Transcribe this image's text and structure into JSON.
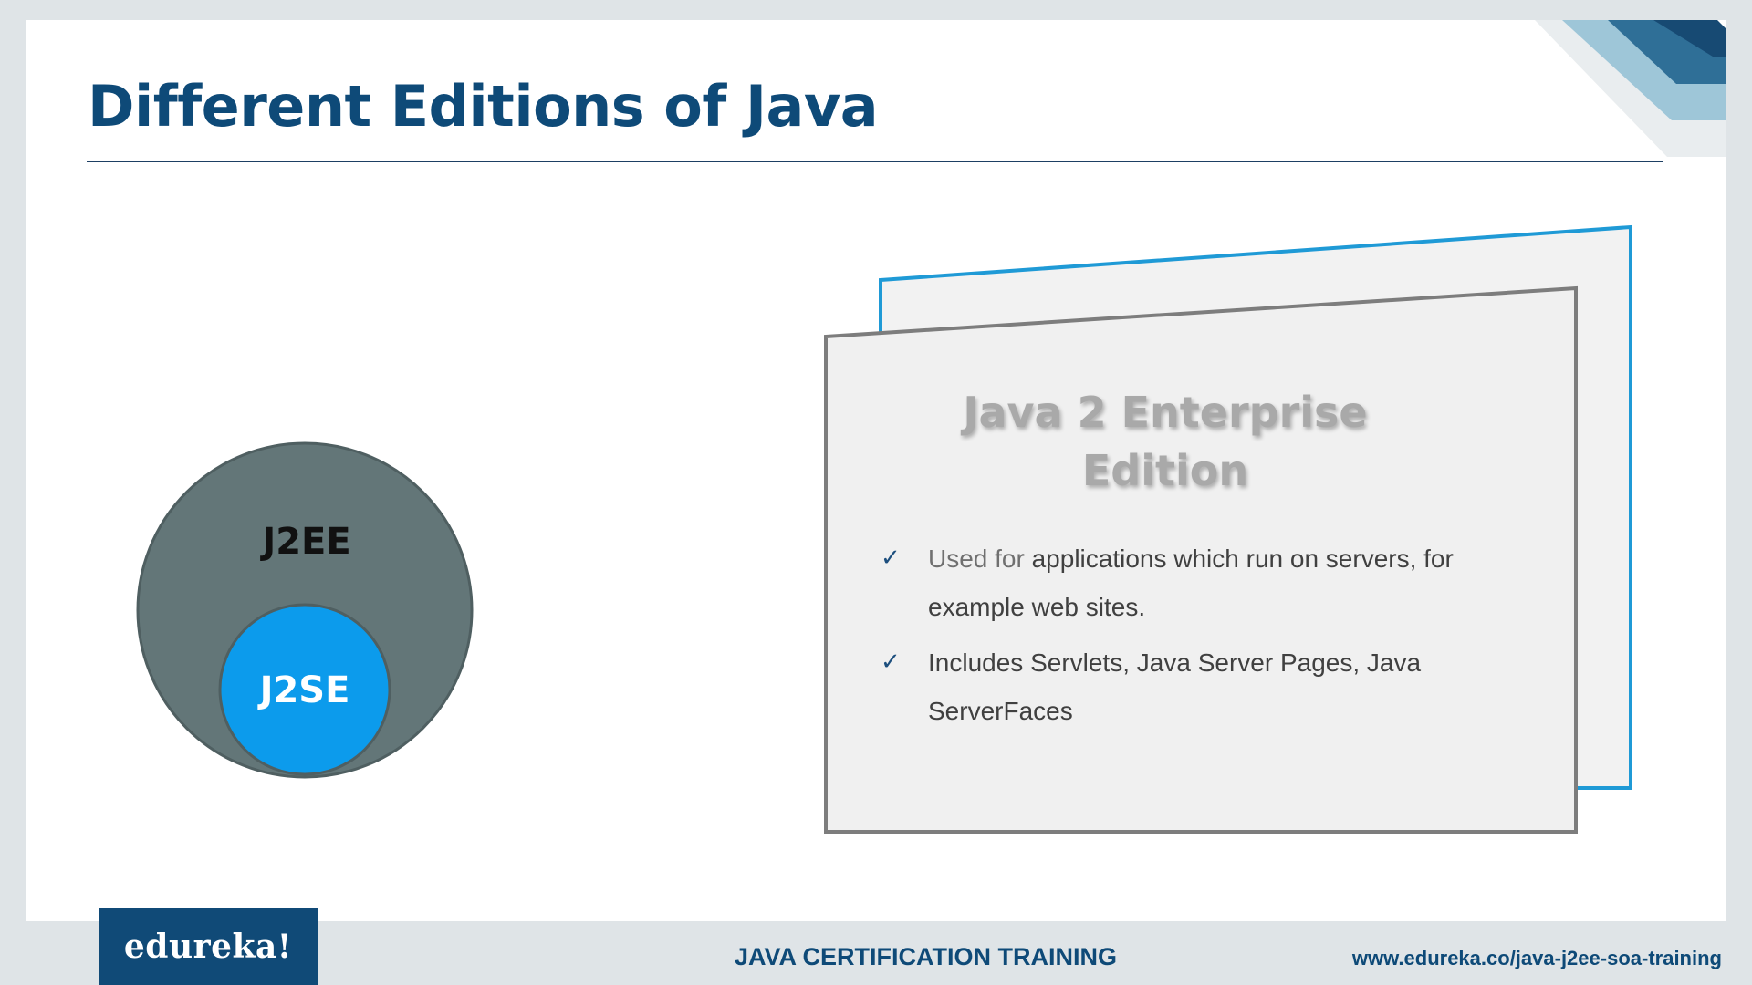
{
  "slide": {
    "title": "Different Editions of Java"
  },
  "venn": {
    "outer_label": "J2EE",
    "inner_label": "J2SE",
    "outer_color": "#637678",
    "inner_color": "#0c9bec"
  },
  "card": {
    "title": "Java 2 Enterprise Edition",
    "back_border_color": "#1f9ad6",
    "bullets": [
      {
        "lead": "Used for ",
        "text": "applications which run on servers, for example web sites."
      },
      {
        "lead": "",
        "text": "Includes Servlets, Java Server Pages, Java ServerFaces"
      }
    ]
  },
  "footer": {
    "logo": "edureka!",
    "course": "JAVA CERTIFICATION TRAINING",
    "url": "www.edureka.co/java-j2ee-soa-training"
  },
  "colors": {
    "brand": "#0e4a78",
    "accent": "#0c9bec"
  }
}
